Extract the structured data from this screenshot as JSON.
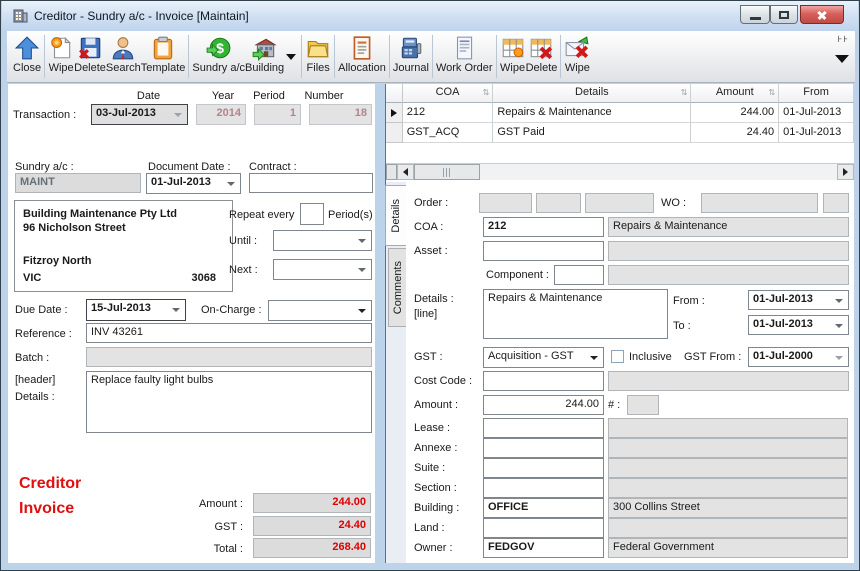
{
  "window": {
    "title": "Creditor - Sundry a/c - Invoice [Maintain]"
  },
  "toolbar": {
    "buttons": [
      {
        "label": "Close"
      },
      {
        "label": "Wipe"
      },
      {
        "label": "Delete"
      },
      {
        "label": "Search"
      },
      {
        "label": "Template"
      },
      {
        "label": "Sundry a/c"
      },
      {
        "label": "Building"
      },
      {
        "label": "Files"
      },
      {
        "label": "Allocation"
      },
      {
        "label": "Journal"
      },
      {
        "label": "Work Order"
      },
      {
        "label": "Wipe"
      },
      {
        "label": "Delete"
      },
      {
        "label": "Wipe"
      }
    ]
  },
  "grid": {
    "columns": [
      "COA",
      "Details",
      "Amount",
      "From"
    ],
    "rows": [
      {
        "coa": "212",
        "details": "Repairs & Maintenance",
        "amount": "244.00",
        "from": "01-Jul-2013"
      },
      {
        "coa": "GST_ACQ",
        "details": "GST Paid",
        "amount": "24.40",
        "from": "01-Jul-2013"
      }
    ]
  },
  "left": {
    "col_headers": {
      "date": "Date",
      "year": "Year",
      "period": "Period",
      "number": "Number"
    },
    "transaction": {
      "label": "Transaction :",
      "date": "03-Jul-2013",
      "year": "2014",
      "period": "1",
      "number": "18"
    },
    "sundry": {
      "label": "Sundry a/c :",
      "value": "MAINT"
    },
    "document_date": {
      "label": "Document Date :",
      "value": "01-Jul-2013"
    },
    "contract": {
      "label": "Contract :",
      "value": ""
    },
    "address": {
      "line1": "Building Maintenance Pty Ltd",
      "line2": "96 Nicholson Street",
      "city": "Fitzroy North",
      "state": "VIC",
      "postcode": "3068"
    },
    "repeat": {
      "label": "Repeat every",
      "suffix": "Period(s)",
      "value": ""
    },
    "until": {
      "label": "Until :",
      "value": ""
    },
    "next": {
      "label": "Next :",
      "value": ""
    },
    "due_date": {
      "label": "Due Date :",
      "value": "15-Jul-2013"
    },
    "on_charge": {
      "label": "On-Charge :",
      "value": ""
    },
    "reference": {
      "label": "Reference :",
      "value": "INV 43261"
    },
    "batch": {
      "label": "Batch :",
      "value": ""
    },
    "header_details": {
      "label1": "[header]",
      "label2": "Details :",
      "value": "Replace faulty light bulbs"
    },
    "doc_type": {
      "line1": "Creditor",
      "line2": "Invoice"
    },
    "totals": {
      "amount": {
        "label": "Amount :",
        "value": "244.00"
      },
      "gst": {
        "label": "GST :",
        "value": "24.40"
      },
      "total": {
        "label": "Total :",
        "value": "268.40"
      }
    }
  },
  "tabs": {
    "details": "Details",
    "comments": "Comments"
  },
  "right": {
    "order": {
      "label": "Order :"
    },
    "wo": {
      "label": "WO :"
    },
    "coa": {
      "label": "COA :",
      "value": "212",
      "desc": "Repairs & Maintenance"
    },
    "asset": {
      "label": "Asset :",
      "value": "",
      "desc": ""
    },
    "component": {
      "label": "Component :",
      "value": "",
      "desc": ""
    },
    "details_line": {
      "label1": "Details :",
      "label2": "[line]",
      "value": "Repairs & Maintenance"
    },
    "from": {
      "label": "From :",
      "value": "01-Jul-2013"
    },
    "to": {
      "label": "To :",
      "value": "01-Jul-2013"
    },
    "gst": {
      "label": "GST :",
      "value": "Acquisition - GST",
      "inclusive_label": "Inclusive",
      "gst_from_label": "GST From :",
      "gst_from_value": "01-Jul-2000"
    },
    "cost_code": {
      "label": "Cost Code :",
      "value": "",
      "desc": ""
    },
    "amount": {
      "label": "Amount :",
      "value": "244.00",
      "hash_label": "# :"
    },
    "lease": {
      "label": "Lease :",
      "value": "",
      "desc": ""
    },
    "annexe": {
      "label": "Annexe :",
      "value": "",
      "desc": ""
    },
    "suite": {
      "label": "Suite :",
      "value": "",
      "desc": ""
    },
    "section": {
      "label": "Section :",
      "value": "",
      "desc": ""
    },
    "building": {
      "label": "Building :",
      "value": "OFFICE",
      "desc": "300 Collins Street"
    },
    "land": {
      "label": "Land :",
      "value": "",
      "desc": ""
    },
    "owner": {
      "label": "Owner :",
      "value": "FEDGOV",
      "desc": "Federal Government"
    }
  }
}
